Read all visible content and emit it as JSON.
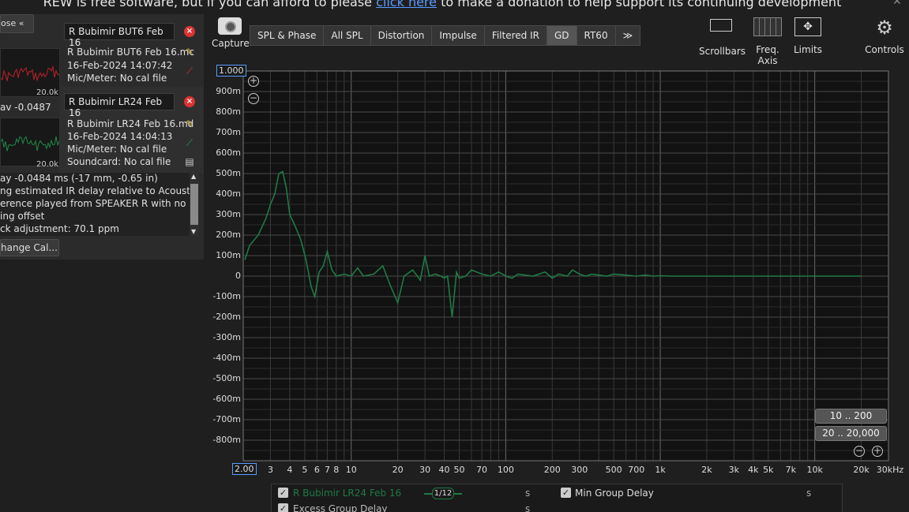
{
  "banner": {
    "before": "REW is free software, but if you can afford to please ",
    "link": "click here",
    "after": " to make a donation to help support its continuing development"
  },
  "left_panel": {
    "collapse_label": "ose",
    "measurements": [
      {
        "name": "R Bubimir BUT6 Feb 16",
        "file": "R Bubimir BUT6 Feb 16.mc",
        "date": "16-Feb-2024 14:07:42",
        "mic": "Mic/Meter: No cal file",
        "thumb_label": "20.0k",
        "thumb_color": "#c0202a",
        "extra": "av -0.0487"
      },
      {
        "name": "R Bubimir LR24 Feb 16",
        "file": "R Bubimir LR24 Feb 16.md",
        "date": "16-Feb-2024 14:04:13",
        "mic": "Mic/Meter: No cal file",
        "soundcard": "Soundcard: No cal file",
        "thumb_label": "20.0k",
        "thumb_color": "#1f8a4a"
      }
    ],
    "messages": [
      "ay -0.0484 ms (-17 mm, -0.65 in)",
      "ng estimated IR delay relative to Acoustic",
      "erence played from SPEAKER R with no",
      "ing offset",
      "ck adjustment: 70.1 ppm"
    ],
    "change_cal_label": "hange Cal..."
  },
  "toolbar": {
    "capture_label": "Capture",
    "tabs": [
      "SPL & Phase",
      "All SPL",
      "Distortion",
      "Impulse",
      "Filtered IR",
      "GD",
      "RT60",
      "≫"
    ],
    "active_tab": "GD",
    "scrollbars_label": "Scrollbars",
    "freq_axis_label": "Freq. Axis",
    "limits_label": "Limits",
    "controls_label": "Controls"
  },
  "chart_data": {
    "type": "line",
    "xscale": "log",
    "xlim": [
      2,
      30000
    ],
    "ylim": [
      -0.9,
      1.0
    ],
    "y_unit": "s",
    "y_top_boxed": "1.000",
    "x_left_boxed": "2.00",
    "y_ticks": [
      "900m",
      "800m",
      "700m",
      "600m",
      "500m",
      "400m",
      "300m",
      "200m",
      "100m",
      "0",
      "-100m",
      "-200m",
      "-300m",
      "-400m",
      "-500m",
      "-600m",
      "-700m",
      "-800m"
    ],
    "y_tick_values": [
      0.9,
      0.8,
      0.7,
      0.6,
      0.5,
      0.4,
      0.3,
      0.2,
      0.1,
      0,
      -0.1,
      -0.2,
      -0.3,
      -0.4,
      -0.5,
      -0.6,
      -0.7,
      -0.8
    ],
    "x_ticks": [
      {
        "v": 3,
        "t": "3"
      },
      {
        "v": 4,
        "t": "4"
      },
      {
        "v": 5,
        "t": "5"
      },
      {
        "v": 6,
        "t": "6"
      },
      {
        "v": 7,
        "t": "7"
      },
      {
        "v": 8,
        "t": "8"
      },
      {
        "v": 10,
        "t": "10"
      },
      {
        "v": 20,
        "t": "20"
      },
      {
        "v": 30,
        "t": "30"
      },
      {
        "v": 40,
        "t": "40"
      },
      {
        "v": 50,
        "t": "50"
      },
      {
        "v": 70,
        "t": "70"
      },
      {
        "v": 100,
        "t": "100"
      },
      {
        "v": 200,
        "t": "200"
      },
      {
        "v": 300,
        "t": "300"
      },
      {
        "v": 500,
        "t": "500"
      },
      {
        "v": 700,
        "t": "700"
      },
      {
        "v": 1000,
        "t": "1k"
      },
      {
        "v": 2000,
        "t": "2k"
      },
      {
        "v": 3000,
        "t": "3k"
      },
      {
        "v": 4000,
        "t": "4k"
      },
      {
        "v": 5000,
        "t": "5k"
      },
      {
        "v": 7000,
        "t": "7k"
      },
      {
        "v": 10000,
        "t": "10k"
      },
      {
        "v": 20000,
        "t": "20k"
      },
      {
        "v": 30000,
        "t": "30kHz"
      }
    ],
    "series": [
      {
        "name": "R Bubimir LR24 Feb 16",
        "color": "#1f7a45",
        "x": [
          2.05,
          2.2,
          2.5,
          2.8,
          3.0,
          3.2,
          3.4,
          3.6,
          3.8,
          4.0,
          4.3,
          4.7,
          5.1,
          5.5,
          5.8,
          6.2,
          6.6,
          7.0,
          7.5,
          8.0,
          9.0,
          10,
          11,
          12,
          14,
          16,
          18,
          20,
          22,
          25,
          28,
          30,
          32,
          35,
          38,
          40,
          42,
          45,
          48,
          50,
          55,
          60,
          70,
          80,
          90,
          100,
          110,
          120,
          150,
          180,
          200,
          220,
          250,
          270,
          300,
          330,
          360,
          400,
          450,
          500,
          600,
          700,
          800,
          900,
          1000,
          1200,
          1500,
          2000,
          3000,
          5000,
          10000,
          20000
        ],
        "y": [
          0.08,
          0.15,
          0.2,
          0.28,
          0.35,
          0.4,
          0.5,
          0.51,
          0.43,
          0.3,
          0.25,
          0.18,
          0.08,
          -0.05,
          -0.1,
          0.02,
          0.05,
          0.12,
          0.03,
          0.0,
          0.01,
          0.0,
          0.04,
          0.0,
          0.01,
          0.05,
          -0.05,
          -0.13,
          0.0,
          0.03,
          -0.02,
          0.1,
          0.0,
          0.01,
          0.0,
          -0.01,
          0.0,
          -0.2,
          0.02,
          -0.01,
          0.0,
          0.03,
          0.01,
          0.0,
          0.02,
          0.0,
          -0.01,
          0.01,
          0.0,
          0.02,
          -0.01,
          0.01,
          0.0,
          0.03,
          0.01,
          0.0,
          0.01,
          0.005,
          0.0,
          0.01,
          0.005,
          0.0,
          0.005,
          0.0,
          0.002,
          0.0,
          0.0,
          0.0,
          0.0,
          0.0,
          0.0,
          0.0
        ]
      }
    ]
  },
  "range_buttons": [
    "10 .. 200",
    "20 .. 20,000"
  ],
  "legend": {
    "rows": [
      {
        "label": "R Bubimir LR24 Feb 16",
        "smoothing": "1/12",
        "unit": "s",
        "checked": "✓",
        "color": "#1f7a45"
      },
      {
        "label": "Excess Group Delay",
        "unit": "s",
        "checked": "✓",
        "color": "#bbbbbb"
      }
    ],
    "min_group_delay": {
      "label": "Min Group Delay",
      "unit": "s",
      "checked": "✓"
    }
  }
}
